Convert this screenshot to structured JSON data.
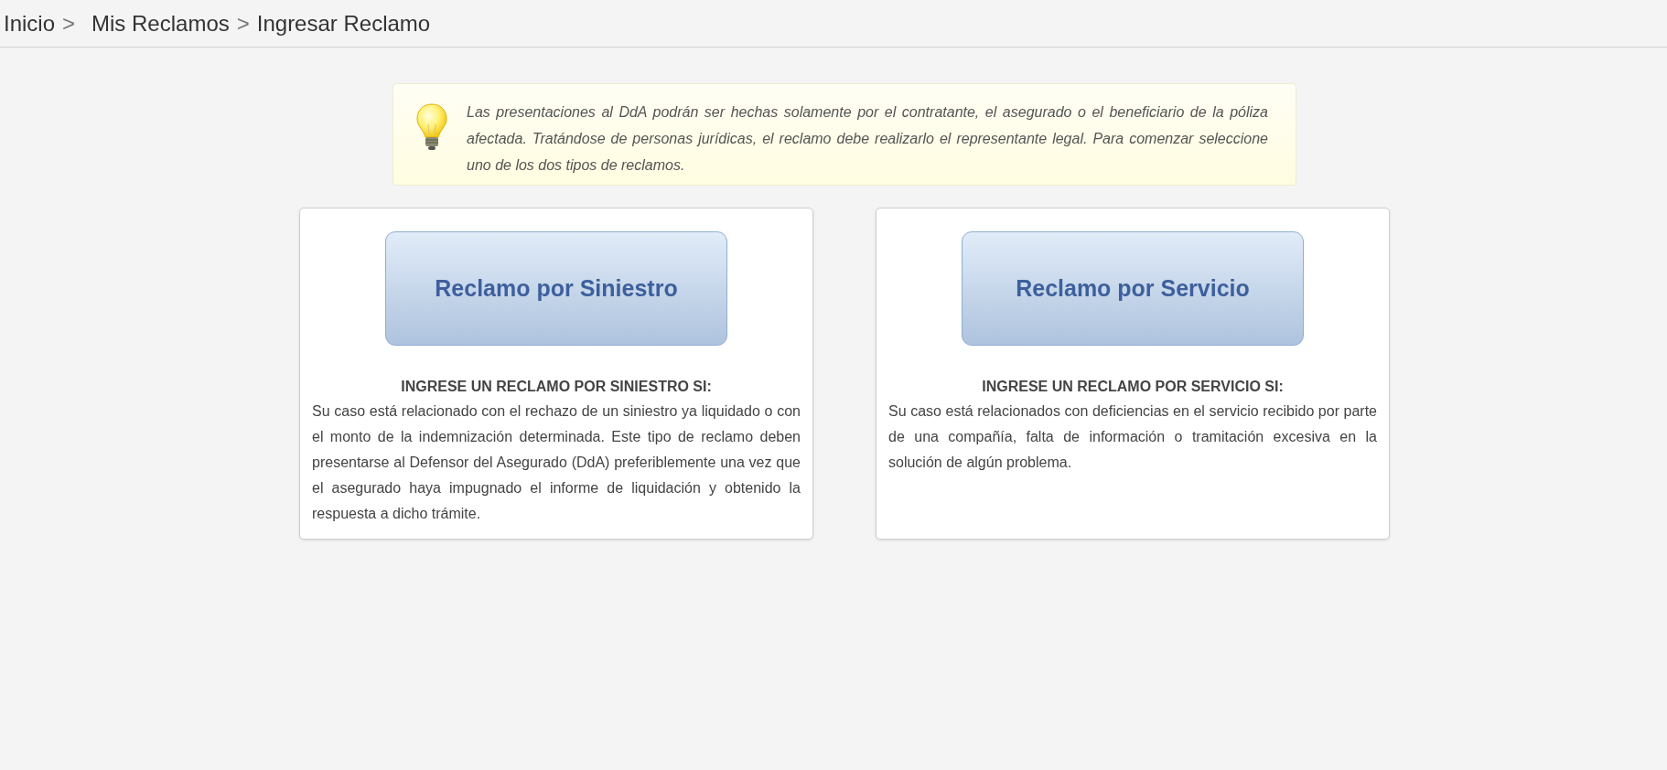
{
  "breadcrumb": [
    {
      "kind": "link",
      "label": "Inicio"
    },
    {
      "kind": "separator",
      "label": ">"
    },
    {
      "kind": "link",
      "label": "Mis Reclamos"
    },
    {
      "kind": "separator",
      "label": ">"
    },
    {
      "kind": "current",
      "label": "Ingresar Reclamo"
    }
  ],
  "notice": {
    "text": "Las presentaciones al DdA podrán ser hechas solamente por el contratante, el asegurado o el beneficiario de la póliza afectada. Tratándose de personas jurídicas, el reclamo debe realizarlo el representante legal. Para comenzar seleccione uno de los dos tipos de reclamos."
  },
  "options": [
    {
      "button": "Reclamo por Siniestro",
      "heading": "INGRESE UN RECLAMO POR SINIESTRO SI:",
      "description": "Su caso está relacionado con el rechazo de un siniestro ya liquidado o con el monto de la indemnización determinada. Este tipo de reclamo deben presentarse al Defensor del Asegurado (DdA) preferiblemente una vez que el asegurado haya impugnado el informe de liquidación y obtenido la respuesta a dicho trámite."
    },
    {
      "button": "Reclamo por Servicio",
      "heading": "INGRESE UN RECLAMO POR SERVICIO SI:",
      "description": "Su caso está relacionados con deficiencias en el servicio recibido por parte de una compañía, falta de información o tramitación excesiva en la solución de algún problema."
    }
  ]
}
